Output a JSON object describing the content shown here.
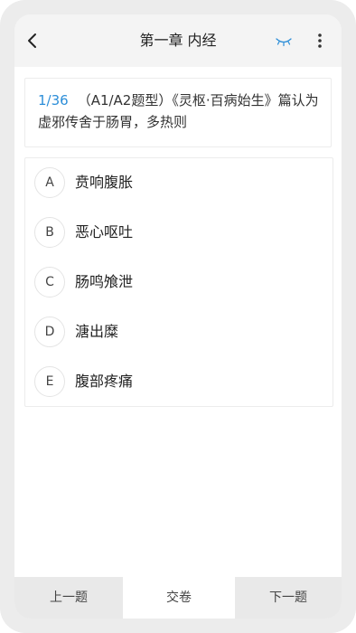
{
  "header": {
    "title": "第一章 内经",
    "back_icon": "chevron-left-icon",
    "eye_icon": "closed-eye-icon",
    "more_icon": "more-vertical-icon",
    "accent_color": "#2c8ed8"
  },
  "question": {
    "number": "1/36",
    "text": "（A1/A2题型）《灵枢·百病始生》篇认为虚邪传舍于肠胃，多热则"
  },
  "options": [
    {
      "letter": "A",
      "text": "贲响腹胀"
    },
    {
      "letter": "B",
      "text": "恶心呕吐"
    },
    {
      "letter": "C",
      "text": "肠鸣飧泄"
    },
    {
      "letter": "D",
      "text": "溏出糜"
    },
    {
      "letter": "E",
      "text": "腹部疼痛"
    }
  ],
  "bottom": {
    "prev_label": "上一题",
    "submit_label": "交卷",
    "next_label": "下一题"
  }
}
